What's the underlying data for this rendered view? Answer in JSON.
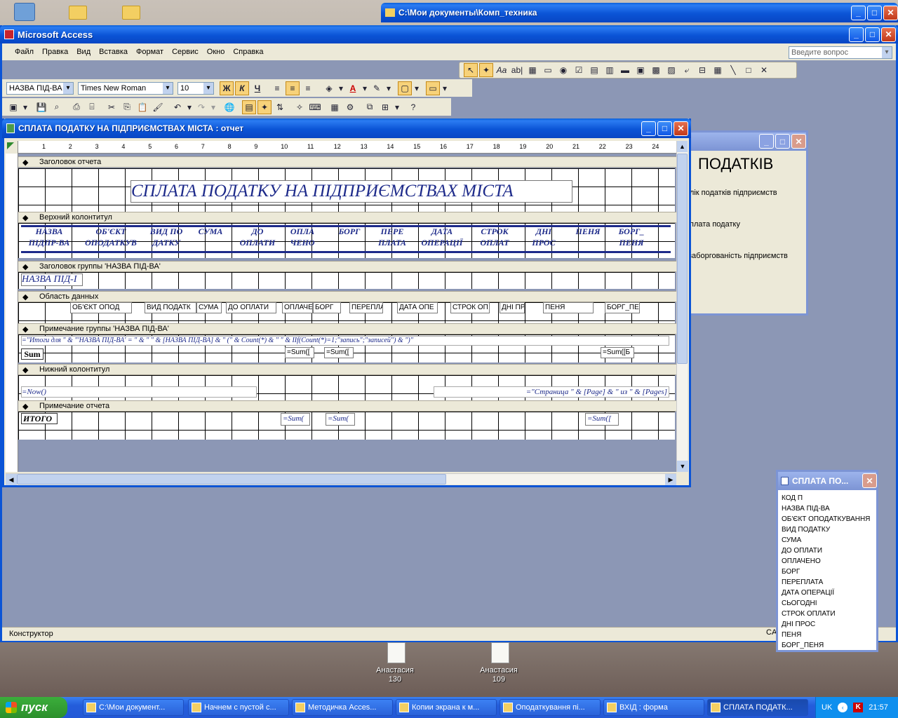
{
  "desktop": {
    "icons": [
      {
        "label": "Анастасия\n130",
        "name": "Анастасия",
        "num": "130"
      },
      {
        "label": "Анастасия\n109",
        "name": "Анастасия",
        "num": "109"
      }
    ]
  },
  "explorer_window": {
    "title": "C:\\Мои документы\\Комп_техника"
  },
  "app": {
    "title": "Microsoft Access",
    "menu": [
      "Файл",
      "Правка",
      "Вид",
      "Вставка",
      "Формат",
      "Сервис",
      "Окно",
      "Справка"
    ],
    "help_placeholder": "Введите вопрос",
    "format_toolbar": {
      "object": "НАЗВА ПІД-ВА",
      "font": "Times New Roman",
      "size": "10",
      "bold": "Ж",
      "italic": "К",
      "underline": "Ч"
    },
    "status": "Конструктор",
    "status_right": "CAPS"
  },
  "report_window": {
    "title": "СПЛАТА ПОДАТКУ НА ПІДПРИЄМСТВАХ МІСТА : отчет",
    "ruler": [
      "1",
      "2",
      "3",
      "4",
      "5",
      "6",
      "7",
      "8",
      "9",
      "10",
      "11",
      "12",
      "13",
      "14",
      "15",
      "16",
      "17",
      "18",
      "19",
      "20",
      "21",
      "22",
      "23",
      "24"
    ],
    "sections": {
      "report_header": "Заголовок отчета",
      "page_header": "Верхний колонтитул",
      "group_header": "Заголовок группы 'НАЗВА ПІД-ВА'",
      "detail": "Область данных",
      "group_footer": "Примечание группы 'НАЗВА ПІД-ВА'",
      "page_footer": "Нижний колонтитул",
      "report_footer": "Примечание отчета"
    },
    "report_title": "СПЛАТА ПОДАТКУ НА ПІДПРИЄМСТВАХ МІСТА",
    "column_headers": [
      "НАЗВА\nПІДПР-ВА",
      "ОБ'ЄКТ\nОПОДАТКУВ",
      "ВИД ПО\nДАТКУ",
      "СУМА",
      "ДО\nОПЛАТИ",
      "ОПЛА\nЧЕНО",
      "БОРГ",
      "ПЕРЕ\nПЛАТА",
      "ДАТА\nОПЕРАЦІЇ",
      "СТРОК\nОПЛАТ",
      "ДНІ\nПРОС",
      "ПЕНЯ",
      "БОРГ_\nПЕНЯ"
    ],
    "group_field": "НАЗВА ПІД-І",
    "detail_fields": [
      "ОБ'ЄКТ ОПОД",
      "ВИД ПОДАТК",
      "СУМА",
      "ДО ОПЛАТИ",
      "ОПЛАЧЕ",
      "БОРГ",
      "ПЕРЕПЛА",
      "ДАТА ОПЕ",
      "СТРОК ОП",
      "ДНІ ПР",
      "ПЕНЯ",
      "БОРГ_ПЕ"
    ],
    "group_footer_expr": "=\"Итоги для \" & \"'НАЗВА ПІД-ВА' = \" & \" \" & [НАЗВА ПІД-ВА] & \" (\" & Count(*) & \" \" & IIf(Count(*)=1;\"запись\";\"записей\") & \")\"",
    "sum_label": "Sum",
    "sum_fields": [
      "=Sum([",
      "=Sum([",
      "=Sum([Б"
    ],
    "now_expr": "=Now()",
    "page_expr": "=\"Страница \" & [Page] & \" из \" & [Pages]",
    "total_label": "ИТОГО",
    "total_sums": [
      "=Sum(",
      "=Sum(",
      "=Sum(["
    ]
  },
  "form_window": {
    "heading": "ПОДАТКІВ",
    "items": [
      "облік податків підприємств",
      "плата податку",
      "заборгованість підприємств"
    ]
  },
  "field_list": {
    "title": "СПЛАТА ПО...",
    "fields": [
      "КОД П",
      "НАЗВА ПІД-ВА",
      "ОБ'ЄКТ ОПОДАТКУВАННЯ",
      "ВИД ПОДАТКУ",
      "СУМА",
      "ДО ОПЛАТИ",
      "ОПЛАЧЕНО",
      "БОРГ",
      "ПЕРЕПЛАТА",
      "ДАТА ОПЕРАЦІЇ",
      "СЬОГОДНІ",
      "СТРОК ОПЛАТИ",
      "ДНІ ПРОС",
      "ПЕНЯ",
      "БОРГ_ПЕНЯ"
    ]
  },
  "taskbar": {
    "start": "пуск",
    "tasks": [
      "C:\\Мои документ...",
      "Начнем с пустой с...",
      "Методичка Acces...",
      "Копии экрана к м...",
      "Оподаткування пі...",
      "ВХІД : форма",
      "СПЛАТА ПОДАТК..."
    ],
    "lang": "UK",
    "time": "21:57"
  }
}
